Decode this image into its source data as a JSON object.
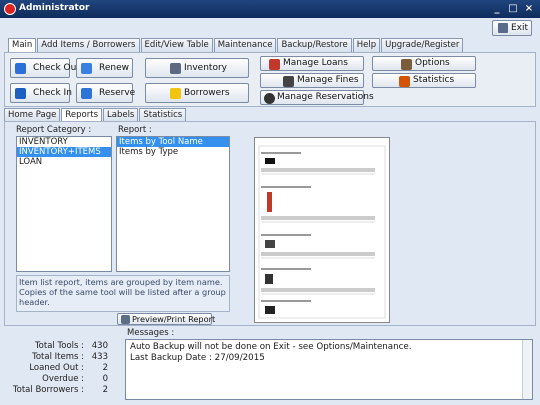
{
  "window": {
    "title": "Administrator",
    "exit_label": "Exit"
  },
  "main_tabs": [
    "Main",
    "Add Items / Borrowers",
    "Edit/View Table",
    "Maintenance",
    "Backup/Restore",
    "Help",
    "Upgrade/Register"
  ],
  "toolbar": {
    "check_out": "Check Out",
    "renew": "Renew",
    "inventory": "Inventory",
    "manage_loans": "Manage Loans",
    "options": "Options",
    "check_in": "Check In",
    "reserve": "Reserve",
    "borrowers": "Borrowers",
    "manage_fines": "Manage Fines",
    "statistics": "Statistics",
    "manage_reservations": "Manage Reservations"
  },
  "sub_tabs": [
    "Home Page",
    "Reports",
    "Labels",
    "Statistics"
  ],
  "reports": {
    "category_label": "Report Category :",
    "report_label": "Report :",
    "categories": [
      "INVENTORY",
      "INVENTORY+ITEMS",
      "LOAN"
    ],
    "selected_category": "INVENTORY+ITEMS",
    "reports": [
      "Items by Tool Name",
      "Items by Type"
    ],
    "selected_report": "Items by Tool Name",
    "description": "Item list report, items are grouped by item name. Copies of the same tool will be listed after a group header.",
    "preview_button": "Preview/Print Report"
  },
  "stats": [
    {
      "label": "Total Tools :",
      "value": "430"
    },
    {
      "label": "Total Items :",
      "value": "433"
    },
    {
      "label": "Loaned Out :",
      "value": "2"
    },
    {
      "label": "Overdue :",
      "value": "0"
    },
    {
      "label": "Total Borrowers :",
      "value": "2"
    }
  ],
  "messages": {
    "label": "Messages :",
    "lines": [
      "Auto Backup will not be done on Exit - see Options/Maintenance.",
      "Last Backup Date : 27/09/2015"
    ]
  }
}
